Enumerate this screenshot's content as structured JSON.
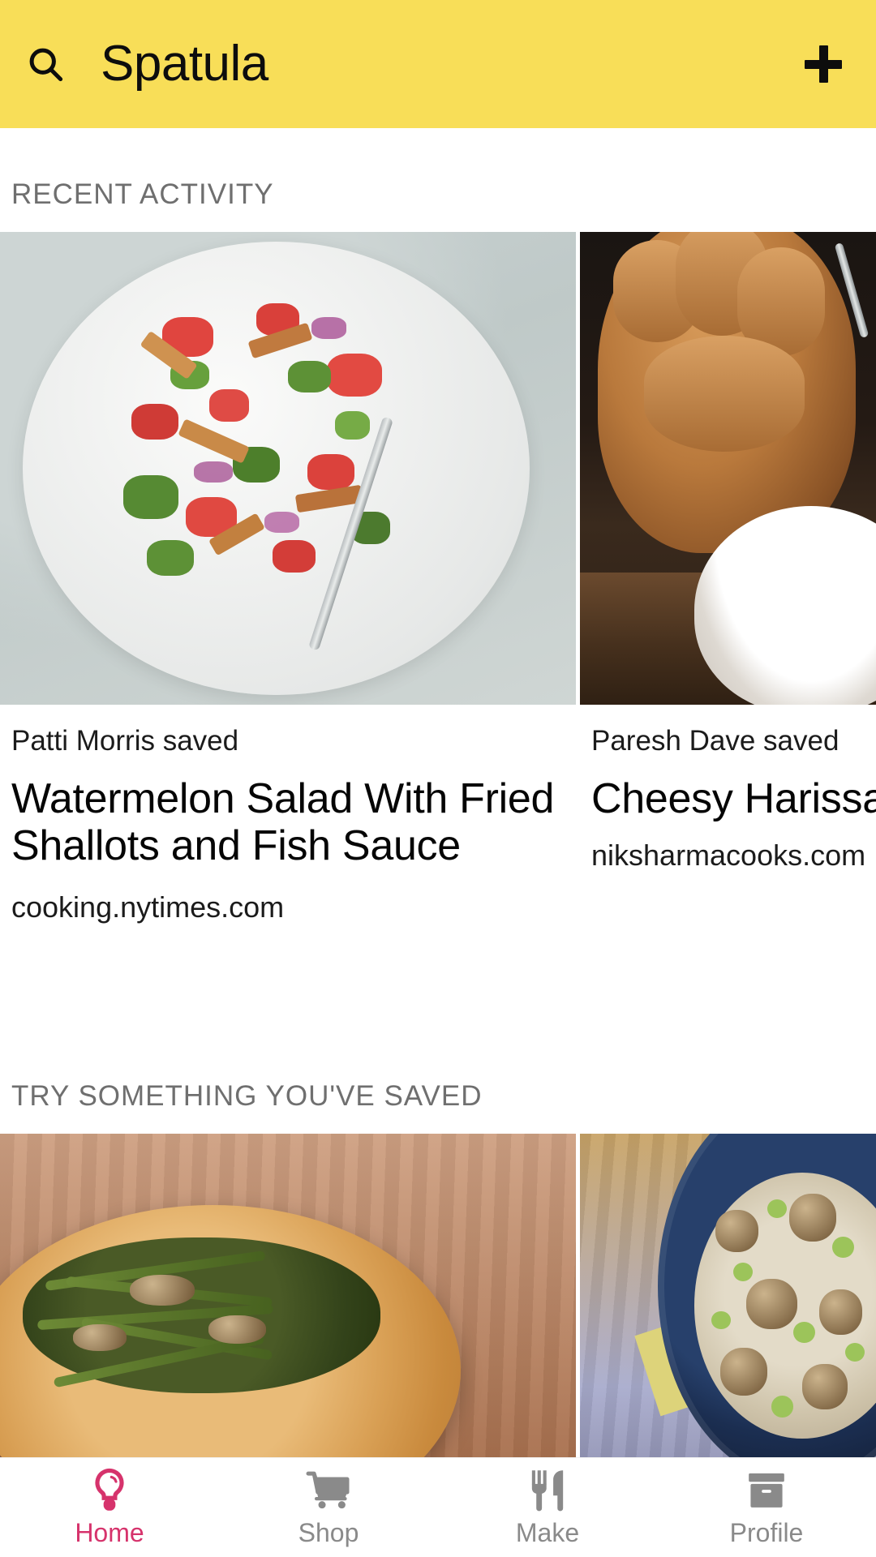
{
  "app": {
    "title": "Spatula",
    "header_bg": "#F8DE58",
    "accent": "#D6336C"
  },
  "header": {
    "search_icon": "search-icon",
    "add_icon": "plus-icon"
  },
  "sections": [
    {
      "label": "RECENT ACTIVITY",
      "cards": [
        {
          "saver": "Patti Morris saved",
          "title": "Watermelon Salad With Fried Shallots and Fish Sauce",
          "site": "cooking.nytimes.com",
          "image_alt": "watermelon-salad-photo"
        },
        {
          "saver": "Paresh Dave saved",
          "title": "Cheesy Harissa",
          "site": "niksharmacooks.com",
          "image_alt": "hands-bowl-photo"
        }
      ]
    },
    {
      "label": "TRY SOMETHING YOU'VE SAVED",
      "cards": [
        {
          "image_alt": "asparagus-galette-photo"
        },
        {
          "image_alt": "mushroom-pasta-bowl-photo"
        }
      ]
    }
  ],
  "bottom_nav": {
    "items": [
      {
        "label": "Home",
        "icon": "lightbulb-icon",
        "active": true
      },
      {
        "label": "Shop",
        "icon": "shopping-cart-icon",
        "active": false
      },
      {
        "label": "Make",
        "icon": "fork-knife-icon",
        "active": false
      },
      {
        "label": "Profile",
        "icon": "archive-box-icon",
        "active": false
      }
    ]
  }
}
